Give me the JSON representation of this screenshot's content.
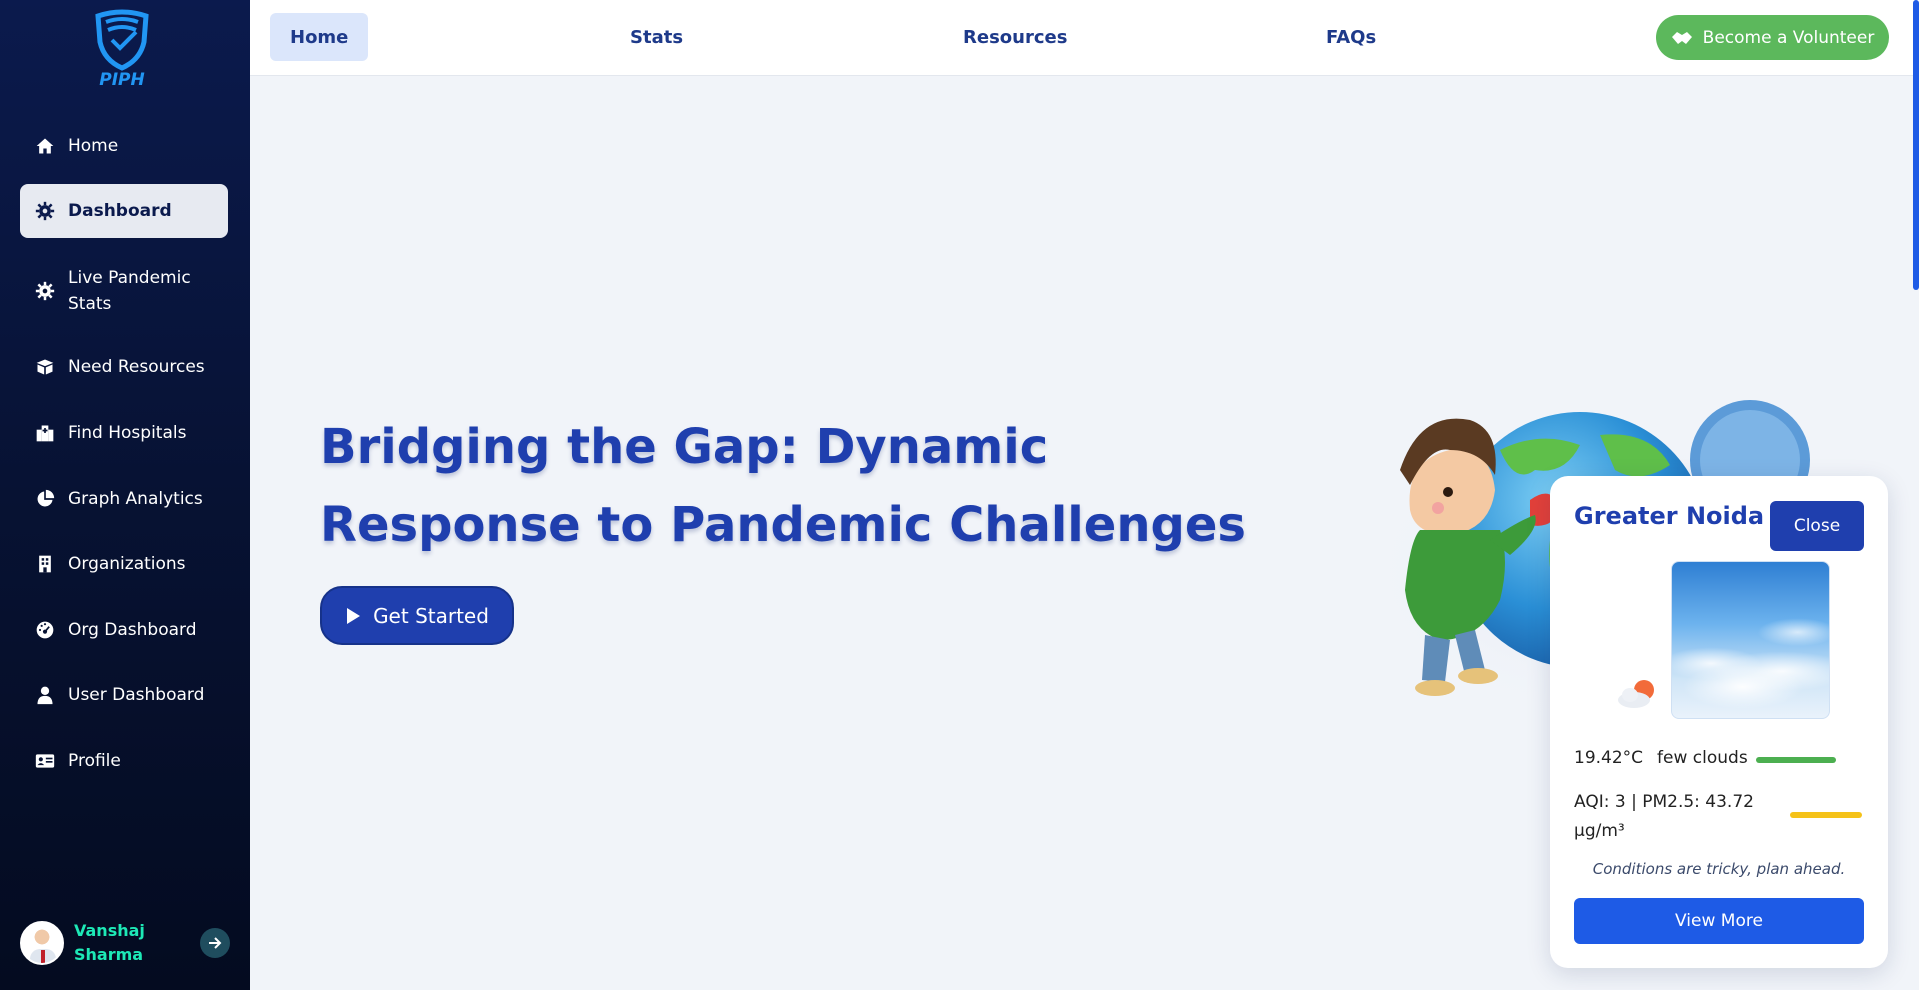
{
  "brand": {
    "logo_text": "PIPH"
  },
  "sidebar": {
    "items": [
      {
        "label": "Home",
        "icon": "home-icon"
      },
      {
        "label": "Dashboard",
        "icon": "gear-icon",
        "active": true
      },
      {
        "label": "Live Pandemic Stats",
        "icon": "gear-icon"
      },
      {
        "label": "Need Resources",
        "icon": "box-icon"
      },
      {
        "label": "Find Hospitals",
        "icon": "hospital-icon"
      },
      {
        "label": "Graph Analytics",
        "icon": "pie-chart-icon"
      },
      {
        "label": "Organizations",
        "icon": "building-icon"
      },
      {
        "label": "Org Dashboard",
        "icon": "gauge-icon"
      },
      {
        "label": "User Dashboard",
        "icon": "user-icon"
      },
      {
        "label": "Profile",
        "icon": "id-card-icon"
      }
    ],
    "user": {
      "name": "Vanshaj Sharma"
    }
  },
  "topnav": {
    "links": [
      "Home",
      "Stats",
      "Resources",
      "FAQs"
    ],
    "active": "Home",
    "volunteer_label": "Become a Volunteer"
  },
  "hero": {
    "title": "Bridging the Gap: Dynamic Response to Pandemic Challenges",
    "cta_label": "Get Started"
  },
  "weather": {
    "city": "Greater Noida",
    "close_label": "Close",
    "temperature": "19.42°C",
    "condition": "few clouds",
    "aqi_text": "AQI: 3 | PM2.5: 43.72 µg/m³",
    "tip": "Conditions are tricky, plan ahead.",
    "view_more_label": "View More",
    "temp_bar_color": "#4caf50",
    "aqi_bar_color": "#f5c218"
  },
  "colors": {
    "primary": "#1f3fae",
    "sidebar_bg": "#071233",
    "volunteer_green": "#5cb85c",
    "accent_blue": "#1e5be6"
  }
}
